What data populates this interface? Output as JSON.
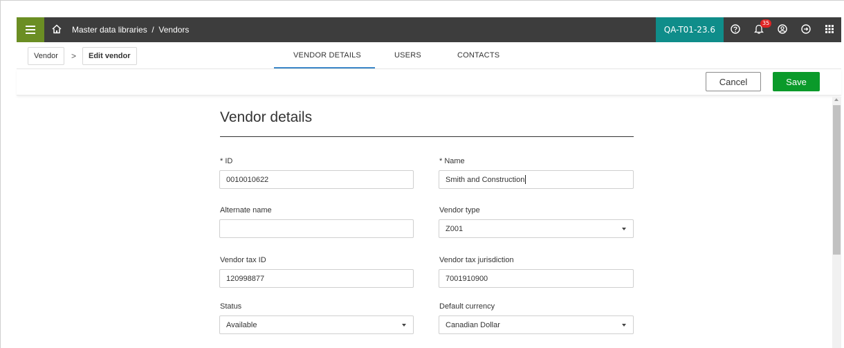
{
  "topbar": {
    "breadcrumb": "Master data libraries  /  Vendors",
    "environment": "QA-T01-23.6",
    "notification_count": "35",
    "icons": [
      "menu-icon",
      "home-icon",
      "help-icon",
      "bell-icon",
      "user-icon",
      "logout-icon",
      "apps-grid-icon"
    ],
    "menu_color": "#6b8e23",
    "env_color": "#0f8d8a"
  },
  "breadcrumb": {
    "items": [
      "Vendor",
      "Edit vendor"
    ],
    "separator": ">"
  },
  "tabs": [
    {
      "label": "VENDOR DETAILS",
      "active": true
    },
    {
      "label": "USERS",
      "active": false
    },
    {
      "label": "CONTACTS",
      "active": false
    }
  ],
  "actions": {
    "cancel_label": "Cancel",
    "save_label": "Save",
    "save_color": "#0a9a2a"
  },
  "form": {
    "title": "Vendor details",
    "fields": {
      "id": {
        "label": "* ID",
        "value": "0010010622"
      },
      "name": {
        "label": "* Name",
        "value": "Smith and Construction"
      },
      "alternate_name": {
        "label": "Alternate name",
        "value": ""
      },
      "vendor_type": {
        "label": "Vendor type",
        "value": "Z001"
      },
      "vendor_tax_id": {
        "label": "Vendor tax ID",
        "value": "120998877"
      },
      "vendor_tax_jurisdiction": {
        "label": "Vendor tax jurisdiction",
        "value": "7001910900"
      },
      "status": {
        "label": "Status",
        "value": "Available"
      },
      "default_currency": {
        "label": "Default currency",
        "value": "Canadian Dollar"
      }
    }
  }
}
